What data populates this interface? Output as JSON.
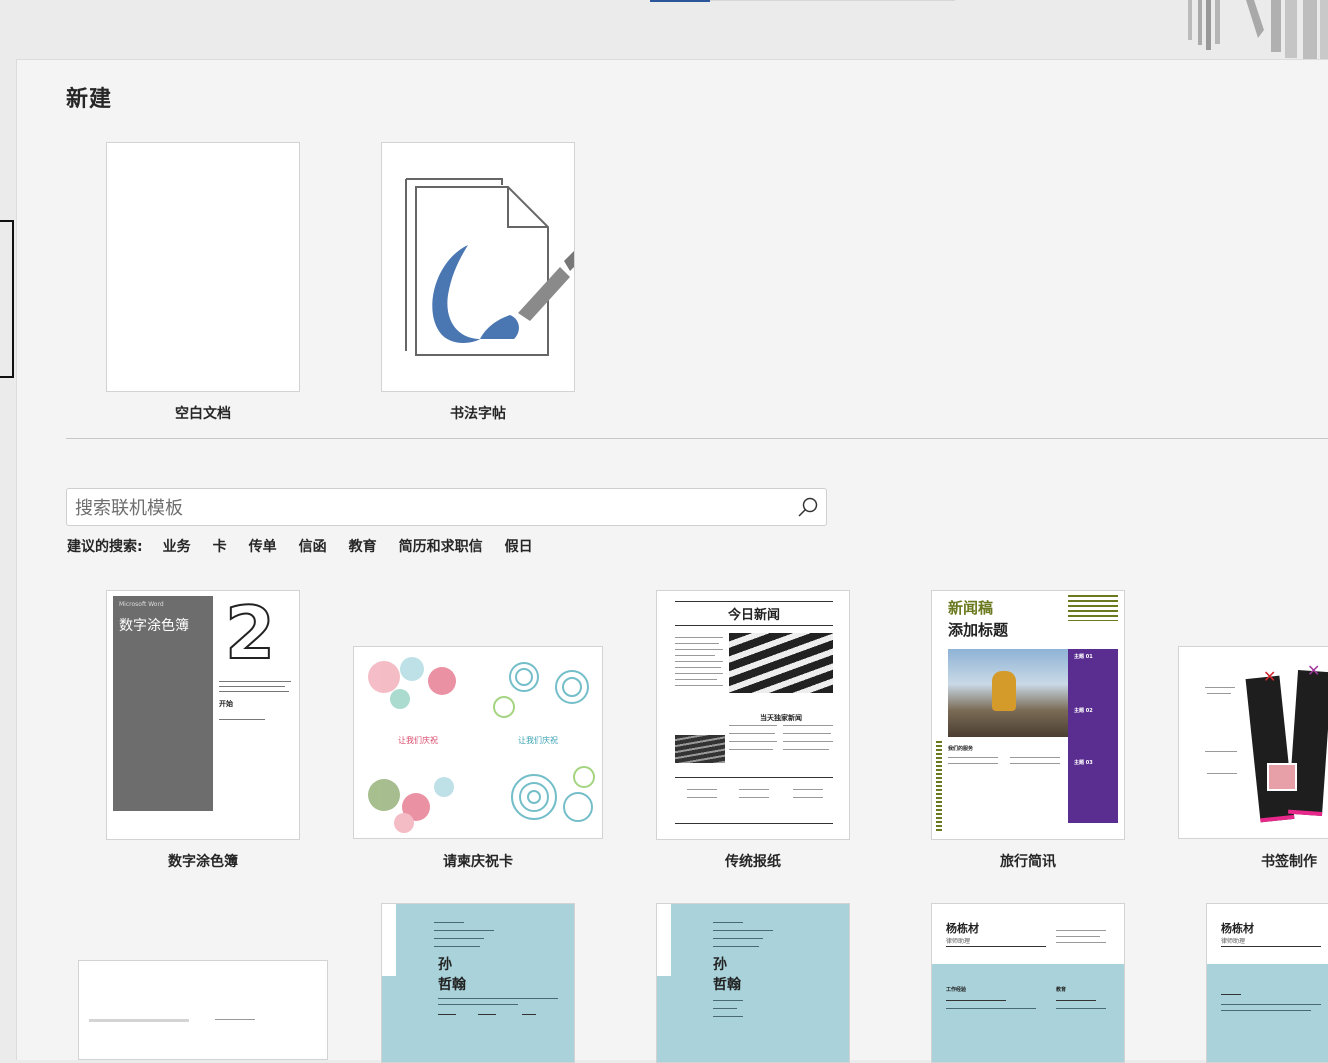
{
  "page": {
    "title": "新建"
  },
  "featured_templates": [
    {
      "name": "空白文档"
    },
    {
      "name": "书法字帖"
    }
  ],
  "search": {
    "placeholder": "搜索联机模板",
    "value": ""
  },
  "suggestions": {
    "label": "建议的搜索:",
    "items": [
      "业务",
      "卡",
      "传单",
      "信函",
      "教育",
      "简历和求职信",
      "假日"
    ]
  },
  "templates": [
    {
      "name": "数字涂色簿",
      "thumb_brand": "Microsoft Word",
      "thumb_title": "数字涂色簿",
      "thumb_start": "开始"
    },
    {
      "name": "请柬庆祝卡",
      "thumb_text_left": "让我们庆祝",
      "thumb_text_right": "让我们庆祝"
    },
    {
      "name": "传统报纸",
      "thumb_title": "今日新闻",
      "thumb_subhead": "当天独家新闻"
    },
    {
      "name": "旅行简讯",
      "thumb_title_1": "新闻稿",
      "thumb_title_2": "添加标题",
      "thumb_topics": [
        "主题 01",
        "主题 02",
        "主题 03"
      ],
      "thumb_section": "我们的服务"
    },
    {
      "name": "书签制作"
    }
  ],
  "templates_row2": [
    {
      "thumb_name_1": "孙",
      "thumb_name_2": "哲翰"
    },
    {
      "thumb_name_1": "孙",
      "thumb_name_2": "哲翰"
    },
    {
      "thumb_name": "杨栋材",
      "thumb_role": "律师助理",
      "thumb_section_left": "工作经验",
      "thumb_section_right": "教育"
    },
    {
      "thumb_name": "杨栋材",
      "thumb_role": "律师助理"
    }
  ],
  "colors": {
    "accent": "#2b579a",
    "coloring_gray": "#6d6d6d",
    "travel_purple": "#5a2e91",
    "travel_olive": "#6b7a1f",
    "resume_teal": "#a9d2da"
  }
}
